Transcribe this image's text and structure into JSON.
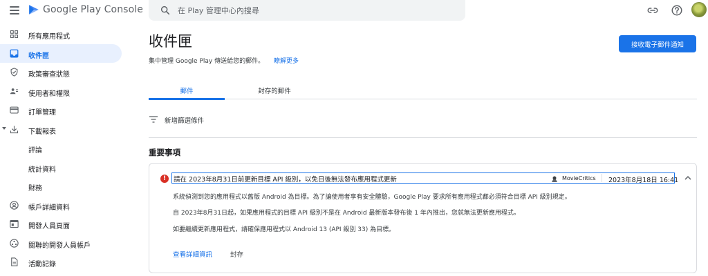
{
  "header": {
    "brand": "Google Play Console",
    "search_placeholder": "在 Play 管理中心內搜尋"
  },
  "sidebar": {
    "items": [
      {
        "label": "所有應用程式",
        "icon": "apps-grid-icon"
      },
      {
        "label": "收件匣",
        "icon": "inbox-icon",
        "active": true
      },
      {
        "label": "政策審查狀態",
        "icon": "shield-check-icon"
      },
      {
        "label": "使用者和權限",
        "icon": "people-icon"
      },
      {
        "label": "訂單管理",
        "icon": "credit-card-icon"
      },
      {
        "label": "下載報表",
        "icon": "download-icon",
        "expanded": true
      },
      {
        "label": "評論",
        "sub": true
      },
      {
        "label": "統計資料",
        "sub": true
      },
      {
        "label": "財務",
        "sub": true
      },
      {
        "label": "帳戶詳細資料",
        "icon": "account-circle-icon"
      },
      {
        "label": "開發人員頁面",
        "icon": "web-page-icon"
      },
      {
        "label": "關聯的開發人員帳戶",
        "icon": "linked-accounts-icon"
      },
      {
        "label": "活動記錄",
        "icon": "document-icon"
      }
    ]
  },
  "main": {
    "title": "收件匣",
    "subtitle": "集中管理 Google Play 傳送給您的郵件。",
    "learn_more": "瞭解更多",
    "primary_button": "接收電子郵件通知",
    "tabs": [
      "郵件",
      "封存的郵件"
    ],
    "active_tab": 0,
    "filter_label": "新增篩選條件",
    "section_title": "重要事項"
  },
  "message": {
    "title": "請在 2023年8月31日前更新目標 API 級別，以免日後無法發布應用程式更新",
    "app_name": "MovieCritics",
    "date": "2023年8月18日 16:41",
    "body": [
      "系統偵測到您的應用程式以舊版 Android 為目標。為了讓使用者享有安全體驗，Google Play 要求所有應用程式都必須符合目標 API 級別規定。",
      "自 2023年8月31日起，如果應用程式的目標 API 級別不是在 Android 最新版本發布後 1 年內推出，您就無法更新應用程式。",
      "如要繼續更新應用程式，請確保應用程式以 Android 13 (API 級別 33) 為目標。"
    ],
    "details_link": "查看詳細資訊",
    "archive_button": "封存"
  },
  "colors": {
    "accent": "#1a73e8",
    "active_bg": "#e8f0fe",
    "error": "#d93025",
    "border": "#dadce0"
  }
}
